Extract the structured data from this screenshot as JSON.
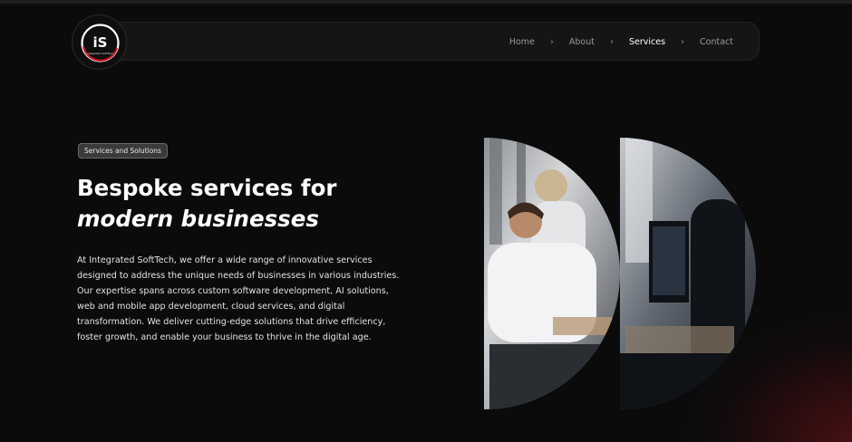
{
  "logo": {
    "text": "iS",
    "subtext": "Integrated SoftTech"
  },
  "nav": {
    "items": [
      {
        "label": "Home",
        "active": false
      },
      {
        "label": "About",
        "active": false
      },
      {
        "label": "Services",
        "active": true
      },
      {
        "label": "Contact",
        "active": false
      }
    ],
    "separator": "›"
  },
  "hero": {
    "badge": "Services and Solutions",
    "title_line1": "Bespoke services for",
    "title_line2": "modern businesses",
    "paragraph": "At Integrated SoftTech, we offer a wide range of innovative services designed to address the unique needs of businesses in various industries. Our expertise spans across custom software development, AI solutions, web and mobile app development, cloud services, and digital transformation. We deliver cutting-edge solutions that drive efficiency, foster growth, and enable your business to thrive in the digital age."
  },
  "colors": {
    "background": "#0b0b0c",
    "navbar": "#151516",
    "accent_glow": "#781416",
    "text_muted": "#9a9a9e"
  }
}
